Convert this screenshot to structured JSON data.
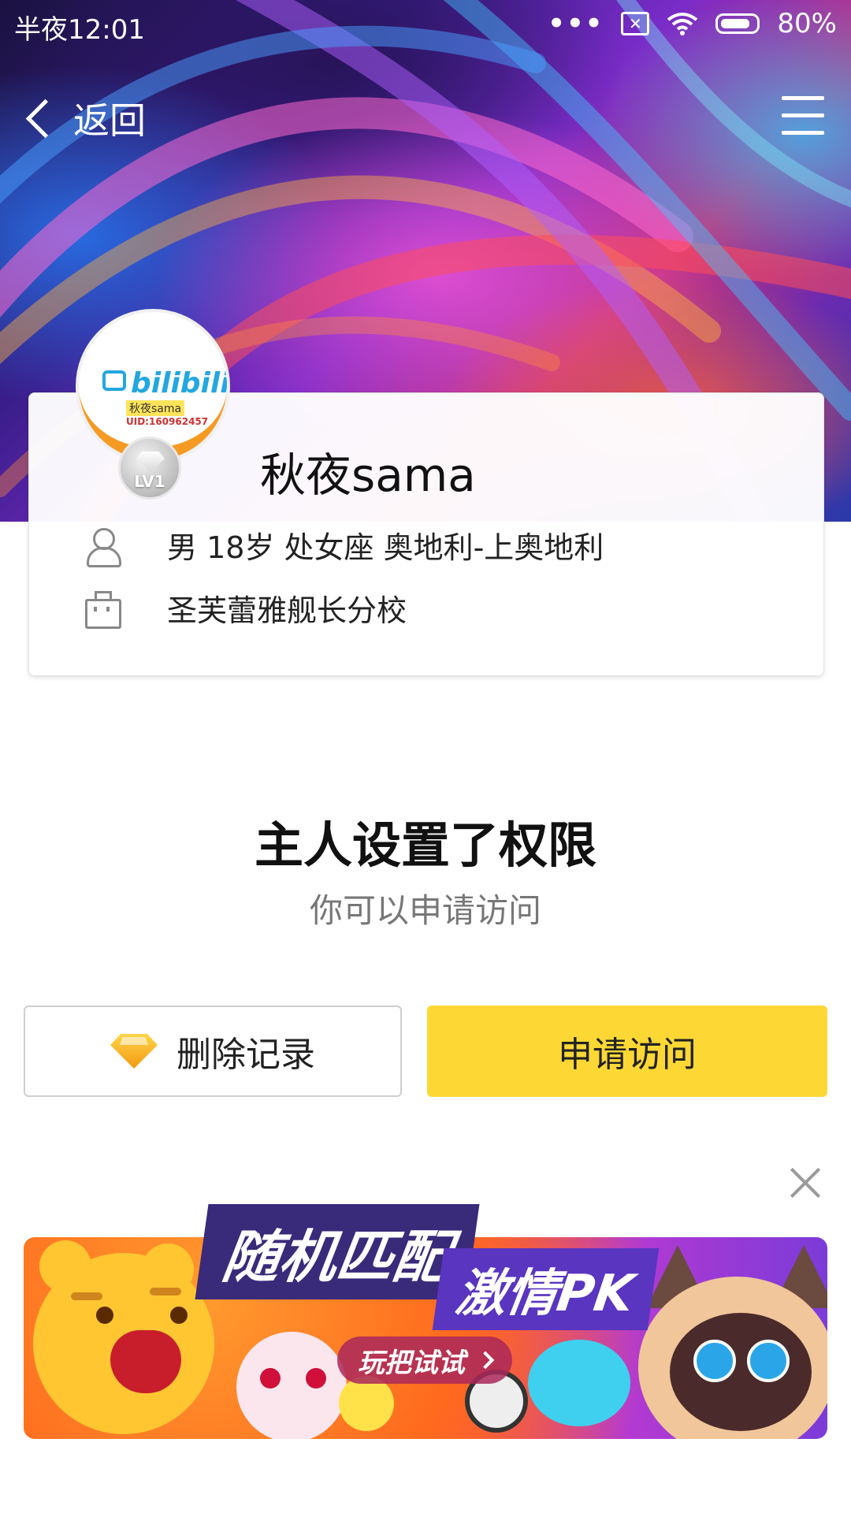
{
  "status_bar": {
    "time": "半夜12:01",
    "battery_text": "80%",
    "icons": [
      "more-dots-icon",
      "no-sim-icon",
      "wifi-icon",
      "battery-icon"
    ]
  },
  "nav": {
    "back_label": "返回",
    "menu_icon": "menu-icon"
  },
  "profile": {
    "username": "秋夜sama",
    "level": "LV1",
    "avatar": {
      "brand": "bilibili",
      "nickname": "秋夜sama",
      "uid": "UID:160962457"
    },
    "details": "男 18岁 处女座 奥地利-上奥地利",
    "school": "圣芙蕾雅舰长分校"
  },
  "permission": {
    "title": "主人设置了权限",
    "subtitle": "你可以申请访问"
  },
  "actions": {
    "delete_label": "删除记录",
    "apply_label": "申请访问"
  },
  "ad": {
    "headline_1": "随机匹配",
    "headline_2": "激情PK",
    "cta": "玩把试试"
  },
  "colors": {
    "apply_button": "#fdd835",
    "avatar_ring": "#f59a23",
    "text_primary": "#111111",
    "text_secondary": "#777777"
  }
}
